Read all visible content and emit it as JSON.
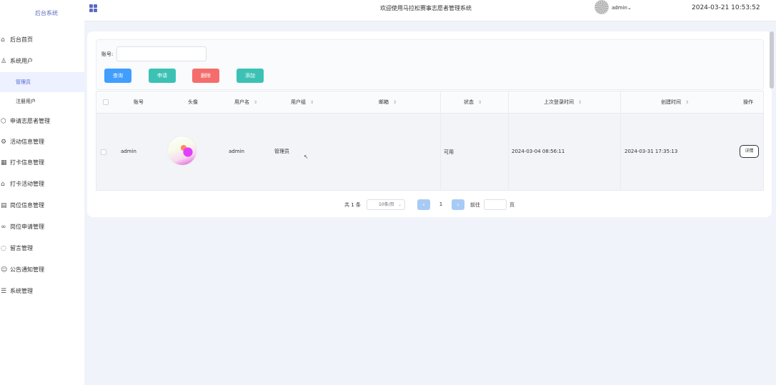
{
  "sidebar": {
    "logo": "后台系统",
    "items": [
      {
        "label": "后台首页",
        "icon": "home-icon",
        "glyph": "⌂"
      },
      {
        "label": "系统用户",
        "icon": "user-icon",
        "glyph": "♙"
      },
      {
        "label": "管理员",
        "sub": true,
        "active": true
      },
      {
        "label": "注册用户",
        "sub": true
      },
      {
        "label": "申请志愿者管理",
        "icon": "cube-icon",
        "glyph": "⬡"
      },
      {
        "label": "活动信息管理",
        "icon": "gear-icon",
        "glyph": "⚙"
      },
      {
        "label": "打卡信息管理",
        "icon": "grid-icon",
        "glyph": "▦"
      },
      {
        "label": "打卡活动管理",
        "icon": "building-icon",
        "glyph": "⌂"
      },
      {
        "label": "岗位信息管理",
        "icon": "table-icon",
        "glyph": "▤"
      },
      {
        "label": "岗位申请管理",
        "icon": "share-icon",
        "glyph": "∞"
      },
      {
        "label": "留言管理",
        "icon": "chat-icon",
        "glyph": "◌"
      },
      {
        "label": "公告通知管理",
        "icon": "people-icon",
        "glyph": "☺"
      },
      {
        "label": "系统管理",
        "icon": "list-icon",
        "glyph": "☰"
      }
    ]
  },
  "header": {
    "title": "欢迎使用马拉松赛事志愿者管理系统",
    "user": "admin",
    "user_chevron": "⌄",
    "datetime": "2024-03-21 10:53:52"
  },
  "search": {
    "label": "账号:",
    "placeholder": "",
    "buttons": {
      "query": "查询",
      "add": "申请",
      "delete": "删除",
      "add2": "添加"
    }
  },
  "table": {
    "sort_glyph": "⇕",
    "headers": {
      "account": "账号",
      "avatar": "头像",
      "username": "用户名",
      "group": "用户组",
      "email": "邮箱",
      "status": "状态",
      "last_login": "上次登录时间",
      "created": "创建时间",
      "action": "操作"
    },
    "rows": [
      {
        "account": "admin",
        "username": "admin",
        "group": "管理员",
        "email": "",
        "status": "可用",
        "last_login": "2024-03-04 08:56:11",
        "created": "2024-03-31 17:35:13",
        "action": "详情"
      }
    ]
  },
  "pagination": {
    "total": "共 1 条",
    "page_size": "10条/页",
    "chevron": "⌄",
    "prev": "‹",
    "current": "1",
    "next": "›",
    "goto_label": "前往",
    "goto_unit": "页"
  },
  "colors": {
    "primary": "#409eff",
    "success": "#3cc2b4",
    "danger": "#f56c6c",
    "brand": "#5c6bc0"
  }
}
